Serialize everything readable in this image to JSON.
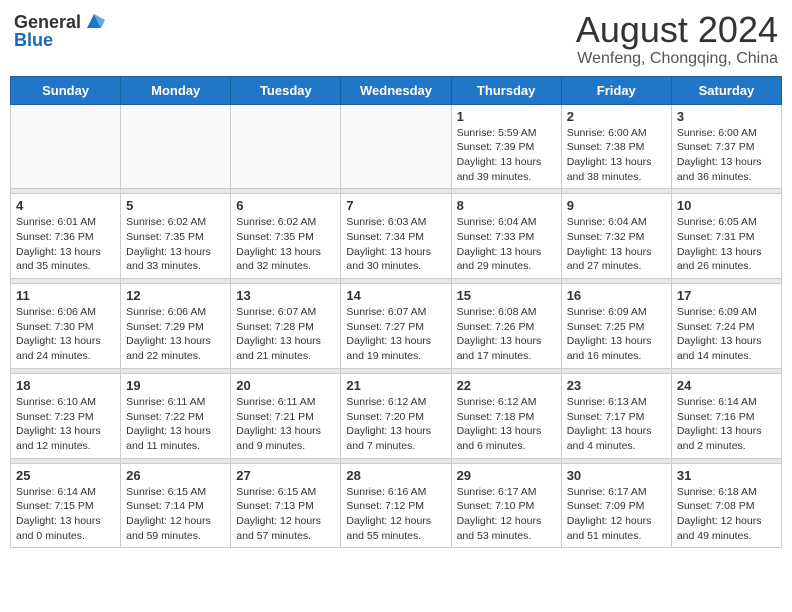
{
  "header": {
    "logo_general": "General",
    "logo_blue": "Blue",
    "title": "August 2024",
    "subtitle": "Wenfeng, Chongqing, China"
  },
  "weekdays": [
    "Sunday",
    "Monday",
    "Tuesday",
    "Wednesday",
    "Thursday",
    "Friday",
    "Saturday"
  ],
  "weeks": [
    [
      {
        "date": "",
        "info": ""
      },
      {
        "date": "",
        "info": ""
      },
      {
        "date": "",
        "info": ""
      },
      {
        "date": "",
        "info": ""
      },
      {
        "date": "1",
        "info": "Sunrise: 5:59 AM\nSunset: 7:39 PM\nDaylight: 13 hours\nand 39 minutes."
      },
      {
        "date": "2",
        "info": "Sunrise: 6:00 AM\nSunset: 7:38 PM\nDaylight: 13 hours\nand 38 minutes."
      },
      {
        "date": "3",
        "info": "Sunrise: 6:00 AM\nSunset: 7:37 PM\nDaylight: 13 hours\nand 36 minutes."
      }
    ],
    [
      {
        "date": "4",
        "info": "Sunrise: 6:01 AM\nSunset: 7:36 PM\nDaylight: 13 hours\nand 35 minutes."
      },
      {
        "date": "5",
        "info": "Sunrise: 6:02 AM\nSunset: 7:35 PM\nDaylight: 13 hours\nand 33 minutes."
      },
      {
        "date": "6",
        "info": "Sunrise: 6:02 AM\nSunset: 7:35 PM\nDaylight: 13 hours\nand 32 minutes."
      },
      {
        "date": "7",
        "info": "Sunrise: 6:03 AM\nSunset: 7:34 PM\nDaylight: 13 hours\nand 30 minutes."
      },
      {
        "date": "8",
        "info": "Sunrise: 6:04 AM\nSunset: 7:33 PM\nDaylight: 13 hours\nand 29 minutes."
      },
      {
        "date": "9",
        "info": "Sunrise: 6:04 AM\nSunset: 7:32 PM\nDaylight: 13 hours\nand 27 minutes."
      },
      {
        "date": "10",
        "info": "Sunrise: 6:05 AM\nSunset: 7:31 PM\nDaylight: 13 hours\nand 26 minutes."
      }
    ],
    [
      {
        "date": "11",
        "info": "Sunrise: 6:06 AM\nSunset: 7:30 PM\nDaylight: 13 hours\nand 24 minutes."
      },
      {
        "date": "12",
        "info": "Sunrise: 6:06 AM\nSunset: 7:29 PM\nDaylight: 13 hours\nand 22 minutes."
      },
      {
        "date": "13",
        "info": "Sunrise: 6:07 AM\nSunset: 7:28 PM\nDaylight: 13 hours\nand 21 minutes."
      },
      {
        "date": "14",
        "info": "Sunrise: 6:07 AM\nSunset: 7:27 PM\nDaylight: 13 hours\nand 19 minutes."
      },
      {
        "date": "15",
        "info": "Sunrise: 6:08 AM\nSunset: 7:26 PM\nDaylight: 13 hours\nand 17 minutes."
      },
      {
        "date": "16",
        "info": "Sunrise: 6:09 AM\nSunset: 7:25 PM\nDaylight: 13 hours\nand 16 minutes."
      },
      {
        "date": "17",
        "info": "Sunrise: 6:09 AM\nSunset: 7:24 PM\nDaylight: 13 hours\nand 14 minutes."
      }
    ],
    [
      {
        "date": "18",
        "info": "Sunrise: 6:10 AM\nSunset: 7:23 PM\nDaylight: 13 hours\nand 12 minutes."
      },
      {
        "date": "19",
        "info": "Sunrise: 6:11 AM\nSunset: 7:22 PM\nDaylight: 13 hours\nand 11 minutes."
      },
      {
        "date": "20",
        "info": "Sunrise: 6:11 AM\nSunset: 7:21 PM\nDaylight: 13 hours\nand 9 minutes."
      },
      {
        "date": "21",
        "info": "Sunrise: 6:12 AM\nSunset: 7:20 PM\nDaylight: 13 hours\nand 7 minutes."
      },
      {
        "date": "22",
        "info": "Sunrise: 6:12 AM\nSunset: 7:18 PM\nDaylight: 13 hours\nand 6 minutes."
      },
      {
        "date": "23",
        "info": "Sunrise: 6:13 AM\nSunset: 7:17 PM\nDaylight: 13 hours\nand 4 minutes."
      },
      {
        "date": "24",
        "info": "Sunrise: 6:14 AM\nSunset: 7:16 PM\nDaylight: 13 hours\nand 2 minutes."
      }
    ],
    [
      {
        "date": "25",
        "info": "Sunrise: 6:14 AM\nSunset: 7:15 PM\nDaylight: 13 hours\nand 0 minutes."
      },
      {
        "date": "26",
        "info": "Sunrise: 6:15 AM\nSunset: 7:14 PM\nDaylight: 12 hours\nand 59 minutes."
      },
      {
        "date": "27",
        "info": "Sunrise: 6:15 AM\nSunset: 7:13 PM\nDaylight: 12 hours\nand 57 minutes."
      },
      {
        "date": "28",
        "info": "Sunrise: 6:16 AM\nSunset: 7:12 PM\nDaylight: 12 hours\nand 55 minutes."
      },
      {
        "date": "29",
        "info": "Sunrise: 6:17 AM\nSunset: 7:10 PM\nDaylight: 12 hours\nand 53 minutes."
      },
      {
        "date": "30",
        "info": "Sunrise: 6:17 AM\nSunset: 7:09 PM\nDaylight: 12 hours\nand 51 minutes."
      },
      {
        "date": "31",
        "info": "Sunrise: 6:18 AM\nSunset: 7:08 PM\nDaylight: 12 hours\nand 49 minutes."
      }
    ]
  ]
}
